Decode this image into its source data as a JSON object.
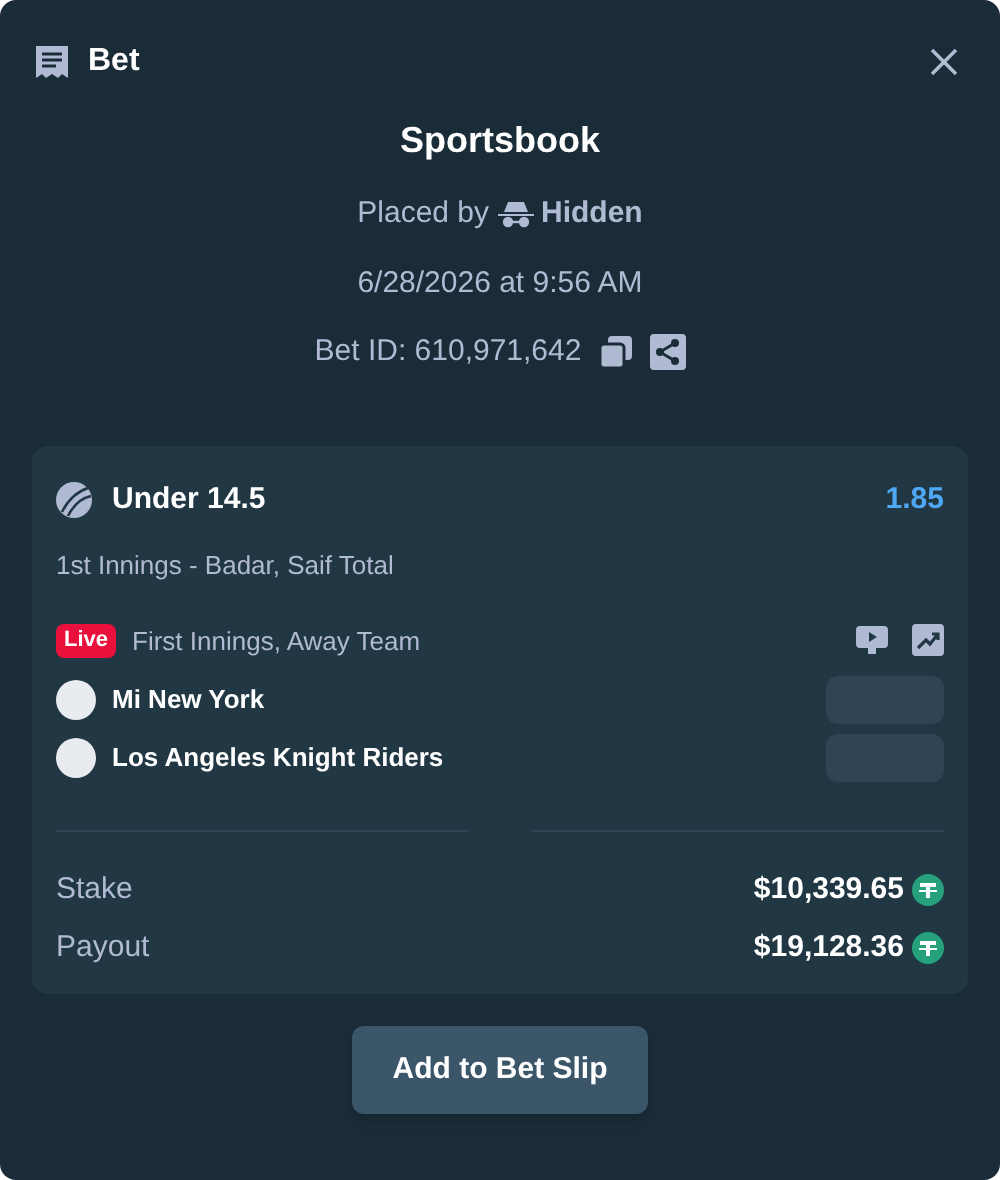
{
  "header": {
    "title": "Bet"
  },
  "source": "Sportsbook",
  "placed_by": {
    "label": "Placed by",
    "user": "Hidden"
  },
  "date": "6/28/2026 at 9:56 AM",
  "bet_id": "Bet ID: 610,971,642",
  "selection": {
    "outcome": "Under 14.5",
    "odds": "1.85",
    "market": "1st Innings - Badar, Saif Total"
  },
  "event": {
    "live": true,
    "live_label": "Live",
    "name": "First Innings, Away Team"
  },
  "teams": [
    {
      "name": "Mi New York"
    },
    {
      "name": "Los Angeles Knight Riders"
    }
  ],
  "totals": [
    {
      "label": "Stake",
      "amount": "$10,339.65"
    },
    {
      "label": "Payout",
      "amount": "$19,128.36"
    }
  ],
  "button": "Add to Bet Slip"
}
